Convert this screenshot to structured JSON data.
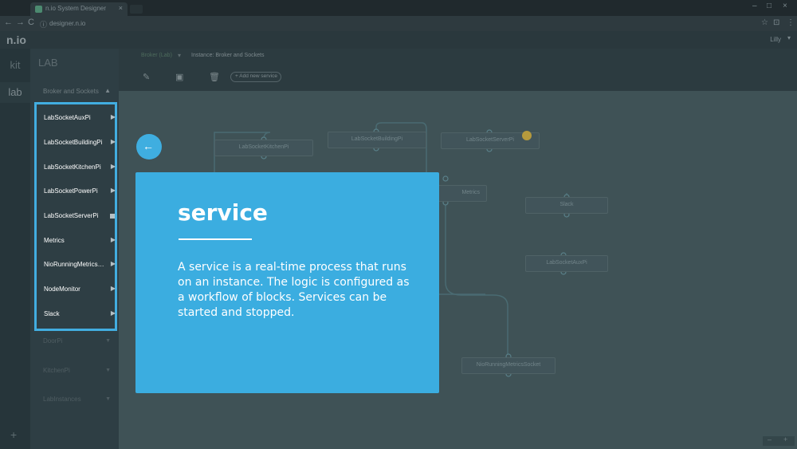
{
  "browser": {
    "tab_title": "n.io System Designer",
    "tab_close": "×",
    "url": "designer.n.io",
    "nav_back": "←",
    "nav_forward": "→",
    "nav_reload": "C",
    "url_icon": "ⓘ",
    "star_icon": "☆",
    "ext_icon": "⊡",
    "menu_icon": "⋮",
    "minimize": "–",
    "maximize": "□",
    "close": "×"
  },
  "app": {
    "logo": "n.io",
    "user": "Lilly"
  },
  "rail": {
    "items": [
      {
        "label": "kit"
      },
      {
        "label": "lab"
      }
    ],
    "add_label": "+"
  },
  "sidebar": {
    "title": "LAB",
    "group": "Broker and Sockets",
    "items": [
      {
        "label": "LabSocketAuxPi",
        "status": "play"
      },
      {
        "label": "LabSocketBuildingPi",
        "status": "play"
      },
      {
        "label": "LabSocketKitchenPi",
        "status": "play"
      },
      {
        "label": "LabSocketPowerPi",
        "status": "play"
      },
      {
        "label": "LabSocketServerPi",
        "status": "stop"
      },
      {
        "label": "Metrics",
        "status": "play"
      },
      {
        "label": "NioRunningMetricsS...",
        "status": "play"
      },
      {
        "label": "NodeMonitor",
        "status": "play"
      },
      {
        "label": "Slack",
        "status": "play"
      }
    ],
    "below": [
      {
        "label": "DoorPi"
      },
      {
        "label": "KitchenPi"
      },
      {
        "label": "LabInstances"
      }
    ]
  },
  "crumbs": {
    "instance": "Broker (Lab)",
    "chevron": "▾",
    "service": "Instance: Broker and Sockets"
  },
  "toolbar": {
    "add_service": "+ Add new service"
  },
  "canvas": {
    "blocks": [
      {
        "label": "LabSocketKitchenPi"
      },
      {
        "label": "LabSocketBuildingPi"
      },
      {
        "label": "LabSocketServerPi"
      },
      {
        "label": "Metrics"
      },
      {
        "label": "Slack"
      },
      {
        "label": "LabSocketAuxPi"
      },
      {
        "label": "NioRunningMetricsSocket"
      }
    ],
    "warning_count": "1"
  },
  "dialog": {
    "back_icon": "←",
    "title": "service",
    "body": "A service is a real-time process that runs on an instance. The logic is configured as a workflow of blocks. Services can be started and stopped."
  },
  "colors": {
    "accent": "#3bade0",
    "highlight_border": "#42ade0"
  }
}
